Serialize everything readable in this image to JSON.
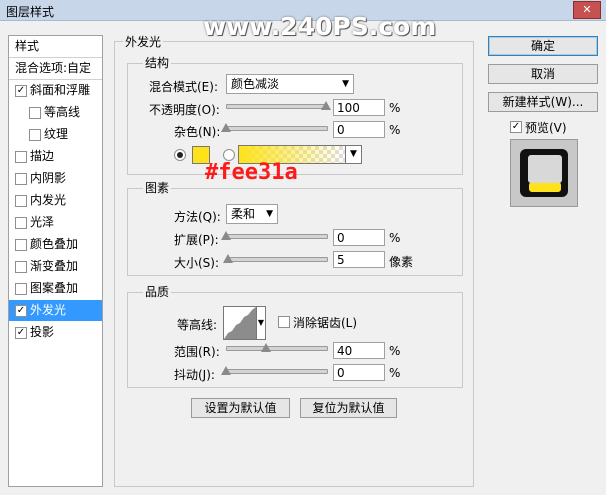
{
  "window": {
    "title": "图层样式",
    "close_label": "✕"
  },
  "watermark": "www.240PS.com",
  "annotation": "#fee31a",
  "colors": {
    "glow": "#fee31a",
    "selected": "#3399ff",
    "annotation": "#ff1a1a"
  },
  "style_list": {
    "header": "样式",
    "blend_options": "混合选项:自定",
    "items": [
      {
        "label": "斜面和浮雕",
        "checked": "✓"
      },
      {
        "label": "等高线",
        "checked": ""
      },
      {
        "label": "纹理",
        "checked": ""
      },
      {
        "label": "描边",
        "checked": ""
      },
      {
        "label": "内阴影",
        "checked": ""
      },
      {
        "label": "内发光",
        "checked": ""
      },
      {
        "label": "光泽",
        "checked": ""
      },
      {
        "label": "颜色叠加",
        "checked": ""
      },
      {
        "label": "渐变叠加",
        "checked": ""
      },
      {
        "label": "图案叠加",
        "checked": ""
      },
      {
        "label": "外发光",
        "checked": "✓"
      },
      {
        "label": "投影",
        "checked": "✓"
      }
    ]
  },
  "panel": {
    "title": "外发光",
    "structure": {
      "legend": "结构",
      "blend_mode_label": "混合模式(E):",
      "blend_mode_value": "颜色减淡",
      "opacity_label": "不透明度(O):",
      "opacity_value": "100",
      "opacity_unit": "%",
      "opacity_level": 100,
      "noise_label": "杂色(N):",
      "noise_value": "0",
      "noise_unit": "%",
      "noise_level": 0
    },
    "elements": {
      "legend": "图素",
      "technique_label": "方法(Q):",
      "technique_value": "柔和",
      "spread_label": "扩展(P):",
      "spread_value": "0",
      "spread_unit": "%",
      "spread_level": 0,
      "size_label": "大小(S):",
      "size_value": "5",
      "size_unit": "像素",
      "size_level": 2
    },
    "quality": {
      "legend": "品质",
      "contour_label": "等高线:",
      "antialias_label": "消除锯齿(L)",
      "range_label": "范围(R):",
      "range_value": "40",
      "range_unit": "%",
      "range_level": 40,
      "jitter_label": "抖动(J):",
      "jitter_value": "0",
      "jitter_unit": "%",
      "jitter_level": 0
    },
    "make_default": "设置为默认值",
    "reset_default": "复位为默认值"
  },
  "buttons": {
    "ok": "确定",
    "cancel": "取消",
    "new_style": "新建样式(W)...",
    "preview_label": "预览(V)",
    "preview_checked": "✓"
  }
}
